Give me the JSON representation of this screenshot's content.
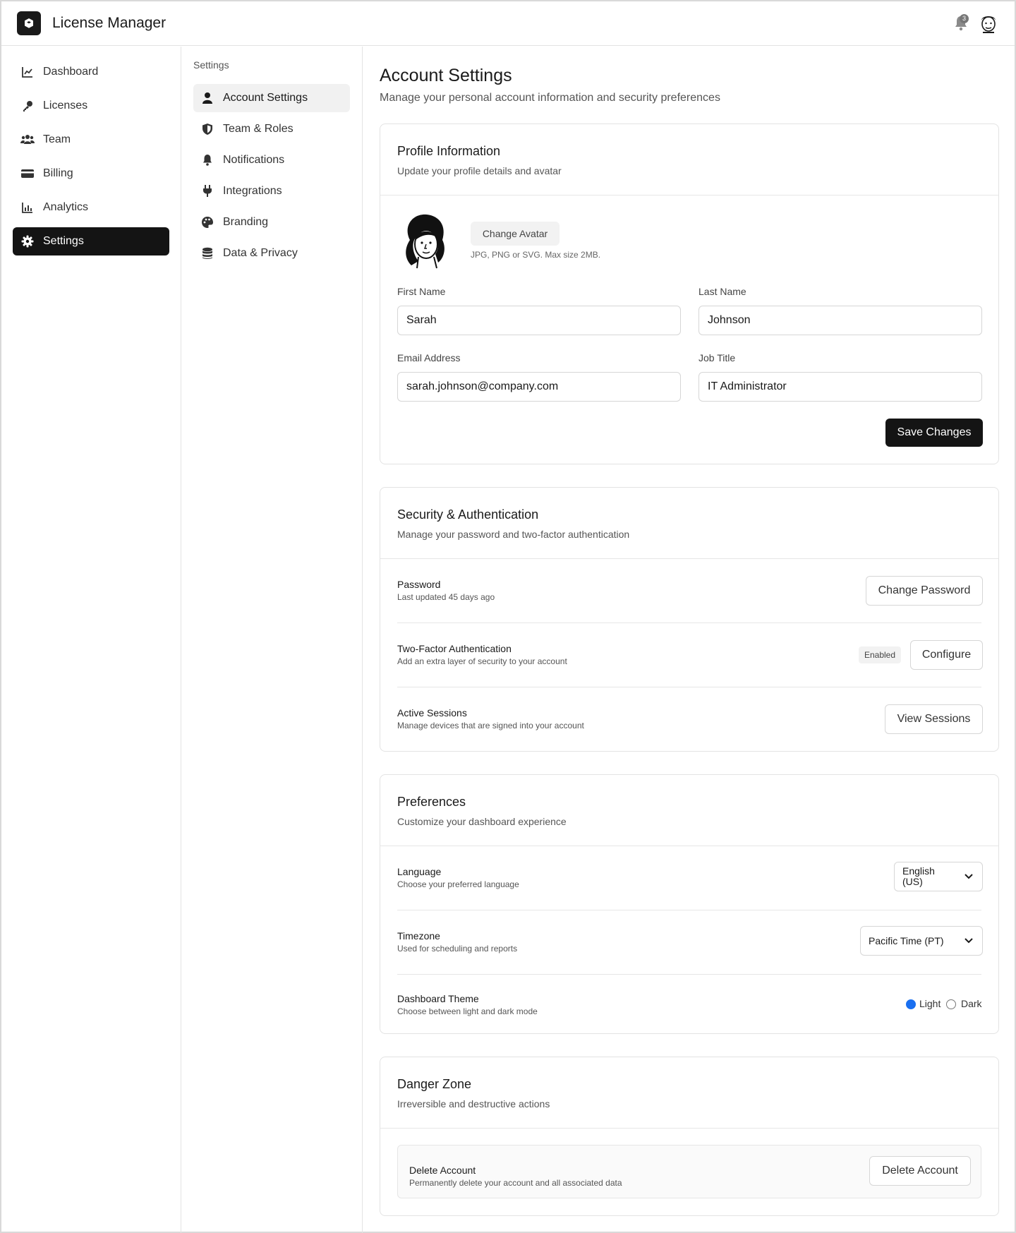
{
  "header": {
    "app_title": "License Manager",
    "notification_count": "3",
    "logo_icon": "cube-icon",
    "bell_icon": "bell-icon",
    "avatar_icon": "user-avatar"
  },
  "sidebar": {
    "items": [
      {
        "label": "Dashboard",
        "icon": "chart-line-icon"
      },
      {
        "label": "Licenses",
        "icon": "key-icon"
      },
      {
        "label": "Team",
        "icon": "users-icon"
      },
      {
        "label": "Billing",
        "icon": "credit-card-icon"
      },
      {
        "label": "Analytics",
        "icon": "bar-chart-icon"
      },
      {
        "label": "Settings",
        "icon": "gear-icon",
        "active": true
      }
    ]
  },
  "subnav": {
    "heading": "Settings",
    "items": [
      {
        "label": "Account Settings",
        "icon": "user-icon",
        "active": true
      },
      {
        "label": "Team & Roles",
        "icon": "shield-icon"
      },
      {
        "label": "Notifications",
        "icon": "bell-icon"
      },
      {
        "label": "Integrations",
        "icon": "plug-icon"
      },
      {
        "label": "Branding",
        "icon": "palette-icon"
      },
      {
        "label": "Data & Privacy",
        "icon": "database-icon"
      }
    ]
  },
  "page": {
    "title": "Account Settings",
    "subtitle": "Manage your personal account information and security preferences"
  },
  "profile": {
    "title": "Profile Information",
    "subtitle": "Update your profile details and avatar",
    "change_avatar_label": "Change Avatar",
    "avatar_hint": "JPG, PNG or SVG. Max size 2MB.",
    "first_name_label": "First Name",
    "first_name_value": "Sarah",
    "last_name_label": "Last Name",
    "last_name_value": "Johnson",
    "email_label": "Email Address",
    "email_value": "sarah.johnson@company.com",
    "job_title_label": "Job Title",
    "job_title_value": "IT Administrator",
    "save_label": "Save Changes"
  },
  "security": {
    "title": "Security & Authentication",
    "subtitle": "Manage your password and two-factor authentication",
    "rows": [
      {
        "title": "Password",
        "sub": "Last updated 45 days ago",
        "button": "Change Password"
      },
      {
        "title": "Two-Factor Authentication",
        "sub": "Add an extra layer of security to your account",
        "badge": "Enabled",
        "button": "Configure"
      },
      {
        "title": "Active Sessions",
        "sub": "Manage devices that are signed into your account",
        "button": "View Sessions"
      }
    ]
  },
  "preferences": {
    "title": "Preferences",
    "subtitle": "Customize your dashboard experience",
    "language": {
      "title": "Language",
      "sub": "Choose your preferred language",
      "value": "English (US)"
    },
    "timezone": {
      "title": "Timezone",
      "sub": "Used for scheduling and reports",
      "value": "Pacific Time (PT)"
    },
    "theme": {
      "title": "Dashboard Theme",
      "sub": "Choose between light and dark mode",
      "options": [
        "Light",
        "Dark"
      ],
      "selected": "Light",
      "accent": "#1a6ff0"
    }
  },
  "danger": {
    "title": "Danger Zone",
    "subtitle": "Irreversible and destructive actions",
    "row_title": "Delete Account",
    "row_sub": "Permanently delete your account and all associated data",
    "button": "Delete Account"
  }
}
